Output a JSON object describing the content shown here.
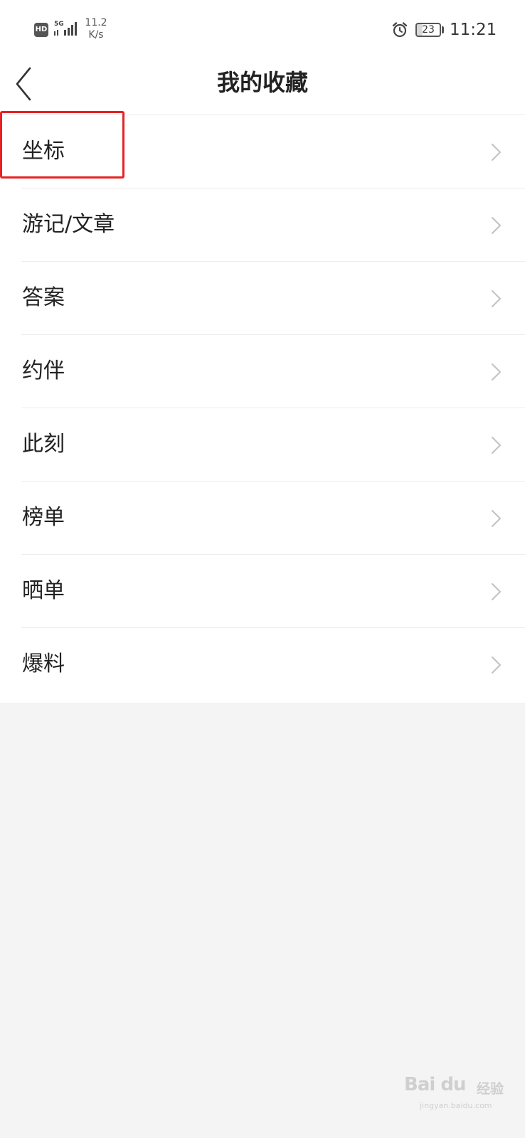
{
  "status_bar": {
    "hd": "HD",
    "network": "5G",
    "speed_value": "11.2",
    "speed_unit": "K/s",
    "battery": "23",
    "time": "11:21"
  },
  "header": {
    "title": "我的收藏"
  },
  "list": [
    {
      "label": "坐标"
    },
    {
      "label": "游记/文章"
    },
    {
      "label": "答案"
    },
    {
      "label": "约伴"
    },
    {
      "label": "此刻"
    },
    {
      "label": "榜单"
    },
    {
      "label": "晒单"
    },
    {
      "label": "爆料"
    }
  ],
  "highlight": {
    "target": "坐标",
    "color": "#e62222"
  },
  "watermark": {
    "logo": "Bai du",
    "suffix": "经验",
    "url": "jingyan.baidu.com"
  },
  "colors": {
    "background": "#f4f4f4",
    "surface": "#ffffff",
    "text": "#222222",
    "chevron": "#c4c4c4",
    "divider": "#ececec"
  }
}
